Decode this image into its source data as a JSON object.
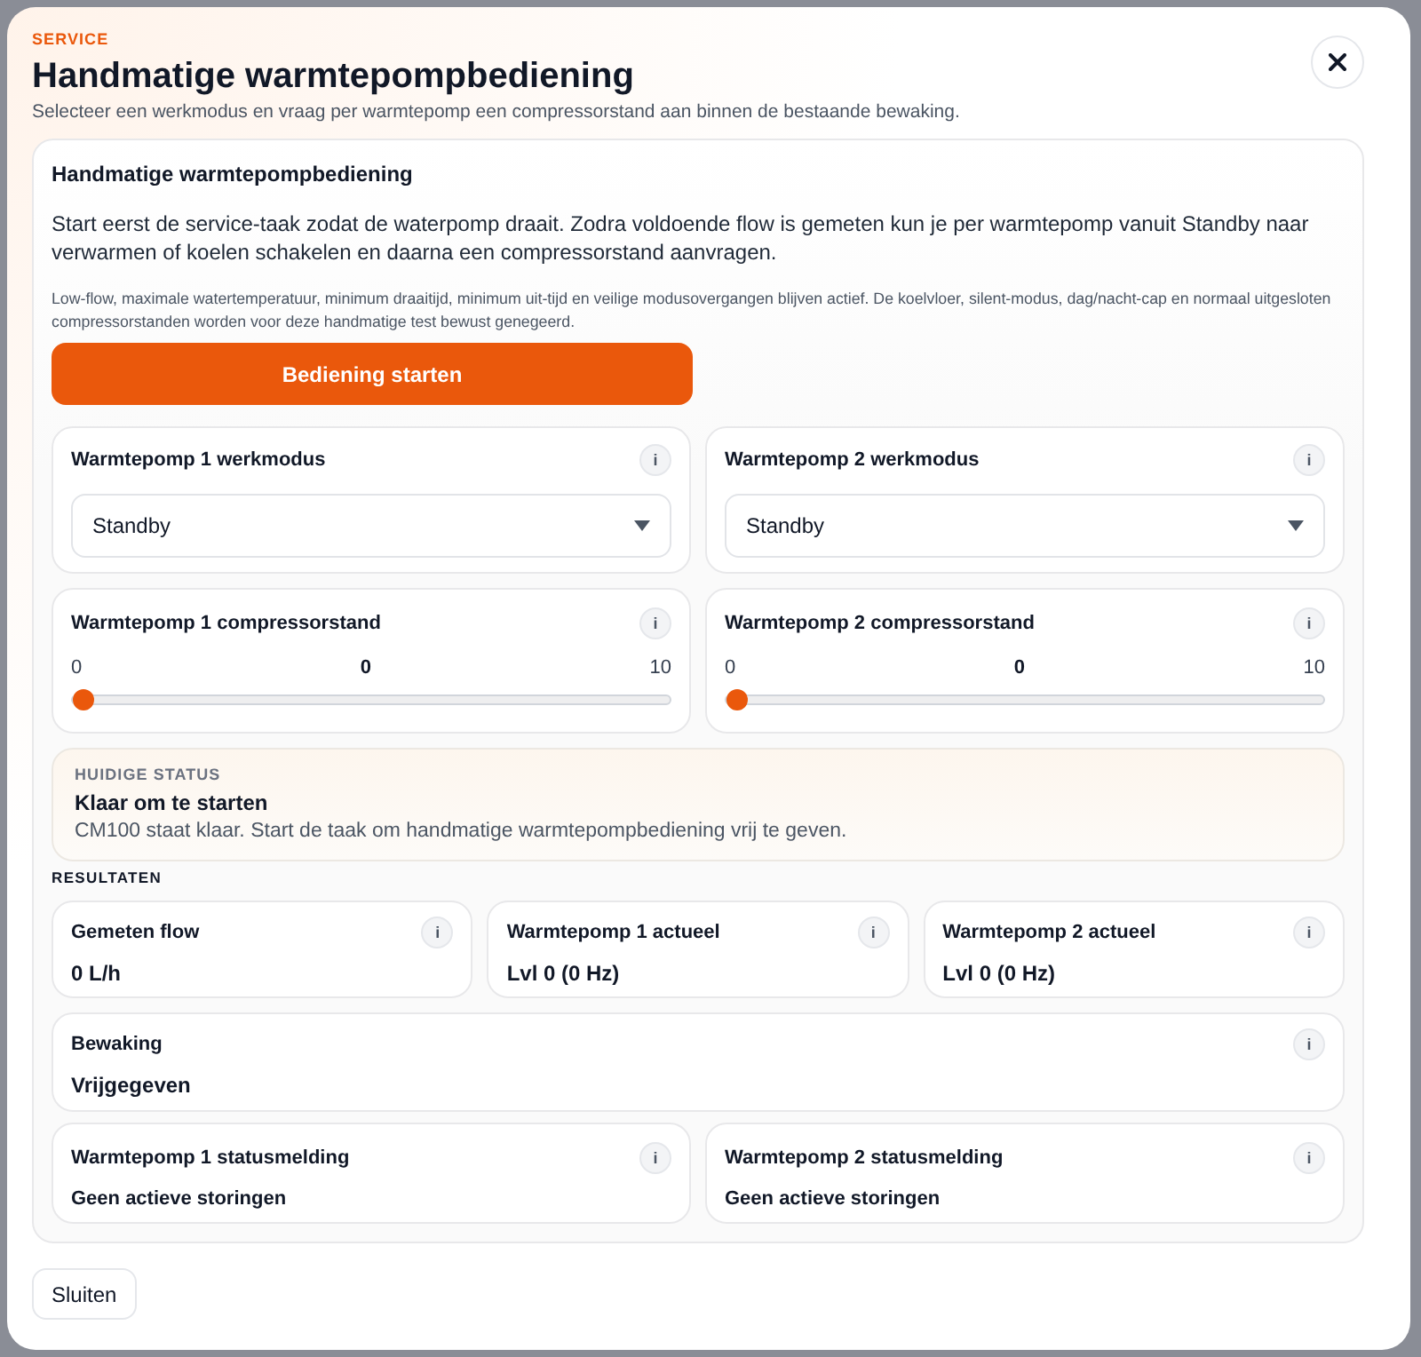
{
  "dialog": {
    "eyebrow": "SERVICE",
    "title": "Handmatige warmtepompbediening",
    "subtitle": "Selecteer een werkmodus en vraag per warmtepomp een compressorstand aan binnen de bestaande bewaking."
  },
  "panel": {
    "heading": "Handmatige warmtepompbediening",
    "intro": "Start eerst de service-taak zodat de waterpomp draait. Zodra voldoende flow is gemeten kun je per warmtepomp vanuit Standby naar verwarmen of koelen schakelen en daarna een compressorstand aanvragen.",
    "note": "Low-flow, maximale watertemperatuur, minimum draaitijd, minimum uit-tijd en veilige modusovergangen blijven actief. De koelvloer, silent-modus, dag/nacht-cap en normaal uitgesloten compressorstanden worden voor deze handmatige test bewust genegeerd.",
    "start_button": "Bediening starten"
  },
  "mode_cards": [
    {
      "label": "Warmtepomp 1 werkmodus",
      "info": "i",
      "value": "Standby"
    },
    {
      "label": "Warmtepomp 2 werkmodus",
      "info": "i",
      "value": "Standby"
    }
  ],
  "compressor_cards": [
    {
      "label": "Warmtepomp 1 compressorstand",
      "info": "i",
      "min": "0",
      "reading": "0",
      "max": "10",
      "level": 0
    },
    {
      "label": "Warmtepomp 2 compressorstand",
      "info": "i",
      "min": "0",
      "reading": "0",
      "max": "10",
      "level": 0
    }
  ],
  "status": {
    "caption": "HUIDIGE STATUS",
    "title": "Klaar om te starten",
    "message": "CM100 staat klaar. Start de taak om handmatige warmtepompbediening vrij te geven."
  },
  "results": {
    "heading": "RESULTATEN",
    "metrics": [
      {
        "label": "Gemeten flow",
        "info": "i",
        "value": "0 L/h"
      },
      {
        "label": "Warmtepomp 1 actueel",
        "info": "i",
        "value": "Lvl 0 (0 Hz)"
      },
      {
        "label": "Warmtepomp 2 actueel",
        "info": "i",
        "value": "Lvl 0 (0 Hz)"
      }
    ],
    "monitoring": {
      "label": "Bewaking",
      "info": "i",
      "value": "Vrijgegeven"
    },
    "status_messages": [
      {
        "label": "Warmtepomp 1 statusmelding",
        "info": "i",
        "value": "Geen actieve storingen"
      },
      {
        "label": "Warmtepomp 2 statusmelding",
        "info": "i",
        "value": "Geen actieve storingen"
      }
    ]
  },
  "footer": {
    "close_button": "Sluiten"
  }
}
